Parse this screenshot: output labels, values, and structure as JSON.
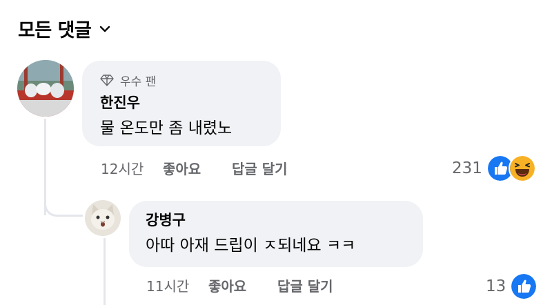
{
  "header": {
    "title": "모든 댓글"
  },
  "comments": [
    {
      "badge": "우수 팬",
      "author": "한진우",
      "text": "물 온도만 좀 내렸노",
      "time": "12시간",
      "like_label": "좋아요",
      "reply_label": "답글 달기",
      "reaction_count": "231",
      "reactions": [
        "like-icon",
        "haha-icon"
      ]
    },
    {
      "author": "강병구",
      "text": "아따 아재 드립이 ㅈ되네요 ㅋㅋ",
      "time": "11시간",
      "like_label": "좋아요",
      "reply_label": "답글 달기",
      "reaction_count": "13",
      "reactions": [
        "like-icon"
      ]
    }
  ],
  "colors": {
    "like_blue": "#1877f2",
    "haha_yellow": "#f7b125",
    "secondary_text": "#65676b",
    "bubble": "#f0f2f5"
  }
}
